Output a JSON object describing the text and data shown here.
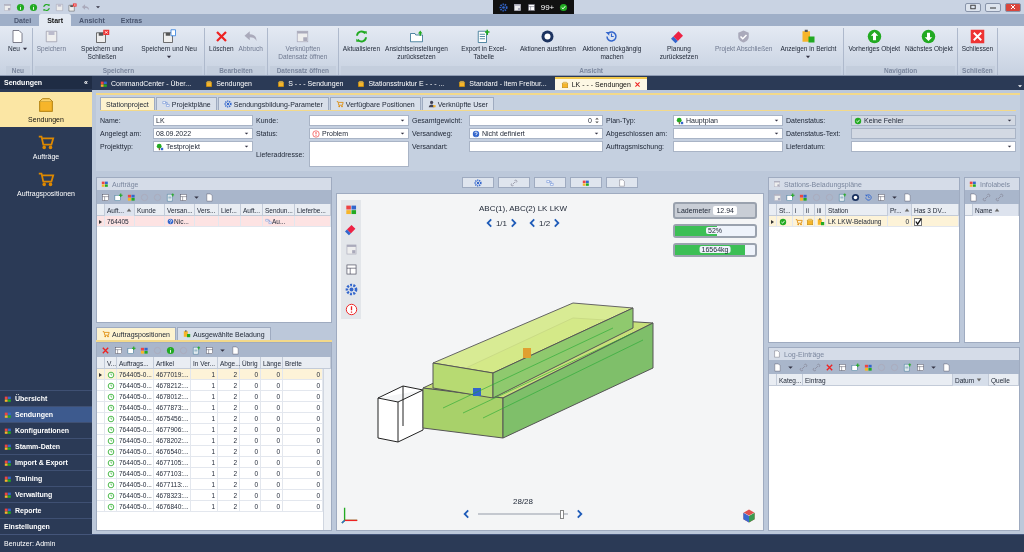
{
  "title_bar": {
    "badge": "99+"
  },
  "ribbon": {
    "tabs": [
      {
        "label": "Datei",
        "selected": false
      },
      {
        "label": "Start",
        "selected": true
      },
      {
        "label": "Ansicht",
        "selected": false
      },
      {
        "label": "Extras",
        "selected": false
      }
    ],
    "groups": [
      {
        "label": "Neu",
        "buttons": [
          {
            "label": "Neu",
            "dropdown": true,
            "disabled": false
          }
        ]
      },
      {
        "label": "Speichern",
        "buttons": [
          {
            "label": "Speichern",
            "dropdown": false,
            "disabled": true
          },
          {
            "label": "Speichern und Schließen",
            "dropdown": false,
            "disabled": false
          },
          {
            "label": "Speichern und Neu",
            "dropdown": true,
            "disabled": false
          }
        ]
      },
      {
        "label": "Bearbeiten",
        "buttons": [
          {
            "label": "Löschen",
            "dropdown": false,
            "disabled": false
          },
          {
            "label": "Abbruch",
            "dropdown": false,
            "disabled": true
          }
        ]
      },
      {
        "label": "Datensatz öffnen",
        "buttons": [
          {
            "label": "Verknüpften Datensatz öffnen",
            "dropdown": false,
            "disabled": true
          }
        ]
      },
      {
        "label": "Ansicht",
        "buttons": [
          {
            "label": "Aktualisieren",
            "dropdown": false,
            "disabled": false
          },
          {
            "label": "Ansichtseinstellungen zurücksetzen",
            "dropdown": false,
            "disabled": false
          },
          {
            "label": "Export in Excel-Tabelle",
            "dropdown": false,
            "disabled": false
          },
          {
            "label": "Aktionen ausführen",
            "dropdown": false,
            "disabled": false
          },
          {
            "label": "Aktionen rückgängig machen",
            "dropdown": false,
            "disabled": false
          },
          {
            "label": "Planung zurücksetzen",
            "dropdown": false,
            "disabled": false
          },
          {
            "label": "Projekt Abschließen",
            "dropdown": false,
            "disabled": true
          },
          {
            "label": "Anzeigen in Bericht",
            "dropdown": true,
            "disabled": false
          }
        ]
      },
      {
        "label": "Navigation",
        "buttons": [
          {
            "label": "Vorheriges Objekt",
            "dropdown": false,
            "disabled": false
          },
          {
            "label": "Nächstes Objekt",
            "dropdown": false,
            "disabled": false
          }
        ]
      },
      {
        "label": "Schließen",
        "buttons": [
          {
            "label": "Schliessen",
            "dropdown": false,
            "disabled": false
          }
        ]
      }
    ]
  },
  "sidebar": {
    "title": "Sendungen",
    "collapse": "«",
    "items": [
      {
        "label": "Sendungen",
        "selected": true
      },
      {
        "label": "Aufträge",
        "selected": false
      },
      {
        "label": "Auftragspositionen",
        "selected": false
      }
    ],
    "nav": [
      {
        "label": "Übersicht",
        "selected": false
      },
      {
        "label": "Sendungen",
        "selected": true
      },
      {
        "label": "Konfigurationen",
        "selected": false
      },
      {
        "label": "Stamm-Daten",
        "selected": false
      },
      {
        "label": "Import & Export",
        "selected": false
      },
      {
        "label": "Training",
        "selected": false
      },
      {
        "label": "Verwaltung",
        "selected": false
      },
      {
        "label": "Reporte",
        "selected": false
      },
      {
        "label": "Einstellungen",
        "selected": false
      }
    ]
  },
  "doc_tabs": [
    {
      "label": "CommandCenter - Über...",
      "selected": false
    },
    {
      "label": "Sendungen",
      "selected": false
    },
    {
      "label": "S - - - Sendungen",
      "selected": false
    },
    {
      "label": "Stationsstruktur E - - - ...",
      "selected": false
    },
    {
      "label": "Standard - item Freibur...",
      "selected": false
    },
    {
      "label": "LK - - - Sendungen",
      "selected": true
    }
  ],
  "form": {
    "tabs": [
      {
        "label": "Stationproject",
        "selected": true
      },
      {
        "label": "Projektpläne",
        "selected": false
      },
      {
        "label": "Sendungsbildung-Parameter",
        "selected": false
      },
      {
        "label": "Verfügbare Positionen",
        "selected": false
      },
      {
        "label": "Verknüpfte User",
        "selected": false
      }
    ],
    "columns": [
      [
        {
          "label": "Name:",
          "value": "LK",
          "kind": "text",
          "disabled": false
        },
        {
          "label": "Angelegt am:",
          "value": "08.09.2022",
          "kind": "combo",
          "disabled": false
        },
        {
          "label": "Projekttyp:",
          "value": "Testprojekt",
          "kind": "combo",
          "disabled": false
        }
      ],
      [
        {
          "label": "Kunde:",
          "kind": "combo",
          "disabled": false
        },
        {
          "label": "Status:",
          "value": "Problem",
          "kind": "combo",
          "disabled": false
        },
        {
          "label": "Lieferaddresse:",
          "kind": "memo",
          "disabled": false
        }
      ],
      [
        {
          "label": "Gesamtgewicht:",
          "value": "0",
          "kind": "spin",
          "disabled": false
        },
        {
          "label": "Versandweg:",
          "value": "Nicht definiert",
          "kind": "combo",
          "disabled": false
        },
        {
          "label": "Versandart:",
          "kind": "text",
          "disabled": false
        }
      ],
      [
        {
          "label": "Plan-Typ:",
          "value": "Hauptplan",
          "kind": "combo",
          "disabled": false
        },
        {
          "label": "Abgeschlossen am:",
          "kind": "combo",
          "disabled": false
        },
        {
          "label": "Auftragsmischung:",
          "kind": "text",
          "disabled": false
        }
      ],
      [
        {
          "label": "Datenstatus:",
          "value": "Keine Fehler",
          "kind": "combo",
          "disabled": true
        },
        {
          "label": "Datenstatus-Text:",
          "kind": "text",
          "disabled": true
        },
        {
          "label": "Lieferdatum:",
          "kind": "combo",
          "disabled": false
        }
      ]
    ]
  },
  "orders": {
    "title": "Aufträge",
    "columns": [
      {
        "label": "Auft...",
        "sorted_ascending": true,
        "sorted_descending": false
      },
      {
        "label": "Kunde",
        "sorted_ascending": false,
        "sorted_descending": false
      },
      {
        "label": "Versan...",
        "sorted_ascending": false,
        "sorted_descending": false
      },
      {
        "label": "Vers...",
        "sorted_ascending": false,
        "sorted_descending": false
      },
      {
        "label": "Lief...",
        "sorted_ascending": false,
        "sorted_descending": false
      },
      {
        "label": "Auft...",
        "sorted_ascending": false,
        "sorted_descending": false
      },
      {
        "label": "Sendun...",
        "sorted_ascending": false,
        "sorted_descending": false
      },
      {
        "label": "Lieferbe...",
        "sorted_ascending": false,
        "sorted_descending": false
      }
    ],
    "rows": [
      {
        "selected": true,
        "cells": [
          {
            "text": "764405"
          },
          {},
          {
            "text": "Nic..."
          },
          {},
          {},
          {},
          {
            "text": "Au..."
          },
          {}
        ]
      }
    ]
  },
  "positions": {
    "tabs": [
      {
        "label": "Auftragspositionen",
        "selected": true
      },
      {
        "label": "Ausgewählte Beladung",
        "selected": false
      }
    ],
    "columns": [
      {
        "label": "V...",
        "sorted_ascending": false,
        "sorted_descending": false
      },
      {
        "label": "Auftrags...",
        "sorted_ascending": false,
        "sorted_descending": false
      },
      {
        "label": "Artikel",
        "sorted_ascending": false,
        "sorted_descending": false
      },
      {
        "label": "In Ver...",
        "sorted_ascending": false,
        "sorted_descending": false
      },
      {
        "label": "Abge...",
        "sorted_ascending": false,
        "sorted_descending": false
      },
      {
        "label": "Übrig",
        "sorted_ascending": false,
        "sorted_descending": false
      },
      {
        "label": "Länge",
        "sorted_ascending": false,
        "sorted_descending": false
      },
      {
        "label": "Breite",
        "sorted_ascending": false,
        "sorted_descending": false
      }
    ],
    "rows": [
      {
        "selected": true,
        "cells": [
          "",
          "764405-0...",
          "4677019:...",
          "1",
          "2",
          "0",
          "0",
          "0"
        ]
      },
      {
        "selected": false,
        "cells": [
          "",
          "764405-0...",
          "4678212:...",
          "1",
          "2",
          "0",
          "0",
          "0"
        ]
      },
      {
        "selected": false,
        "cells": [
          "",
          "764405-0...",
          "4678012:...",
          "1",
          "2",
          "0",
          "0",
          "0"
        ]
      },
      {
        "selected": false,
        "cells": [
          "",
          "764405-0...",
          "4677873:...",
          "1",
          "2",
          "0",
          "0",
          "0"
        ]
      },
      {
        "selected": false,
        "cells": [
          "",
          "764405-0...",
          "4675456:...",
          "1",
          "2",
          "0",
          "0",
          "0"
        ]
      },
      {
        "selected": false,
        "cells": [
          "",
          "764405-0...",
          "4677906:...",
          "1",
          "2",
          "0",
          "0",
          "0"
        ]
      },
      {
        "selected": false,
        "cells": [
          "",
          "764405-0...",
          "4678202:...",
          "1",
          "2",
          "0",
          "0",
          "0"
        ]
      },
      {
        "selected": false,
        "cells": [
          "",
          "764405-0...",
          "4676540:...",
          "1",
          "2",
          "0",
          "0",
          "0"
        ]
      },
      {
        "selected": false,
        "cells": [
          "",
          "764405-0...",
          "4677105:...",
          "1",
          "2",
          "0",
          "0",
          "0"
        ]
      },
      {
        "selected": false,
        "cells": [
          "",
          "764405-0...",
          "4677103:...",
          "1",
          "2",
          "0",
          "0",
          "0"
        ]
      },
      {
        "selected": false,
        "cells": [
          "",
          "764405-0...",
          "4677113:...",
          "1",
          "2",
          "0",
          "0",
          "0"
        ]
      },
      {
        "selected": false,
        "cells": [
          "",
          "764405-0...",
          "4678323:...",
          "1",
          "2",
          "0",
          "0",
          "0"
        ]
      },
      {
        "selected": false,
        "cells": [
          "",
          "764405-0...",
          "4676840:...",
          "1",
          "2",
          "0",
          "0",
          "0"
        ]
      }
    ]
  },
  "viewer": {
    "title": "ABC(1), ABC(2)  LK LKW",
    "page_left": "1/1",
    "page_right": "1/2",
    "lademeter_label": "Lademeter",
    "lademeter_value": "12.94",
    "meters": [
      {
        "reading": "52%",
        "level": 0.52
      },
      {
        "reading": "16564kg",
        "level": 0.87
      }
    ],
    "frame": "28/28",
    "slider": {
      "level": 0.95
    }
  },
  "stations": {
    "title": "Stations-Beladungspläne",
    "columns": [
      {
        "label": "St...",
        "sorted_ascending": false,
        "sorted_descending": false
      },
      {
        "label": "i",
        "sorted_ascending": false,
        "sorted_descending": false
      },
      {
        "label": "ii",
        "sorted_ascending": false,
        "sorted_descending": false
      },
      {
        "label": "iii",
        "sorted_ascending": false,
        "sorted_descending": false
      },
      {
        "label": "Station",
        "sorted_ascending": false,
        "sorted_descending": false
      },
      {
        "label": "Pr...",
        "sorted_ascending": true,
        "sorted_descending": false
      },
      {
        "label": "Has 3 DV...",
        "sorted_ascending": false,
        "sorted_descending": false
      }
    ],
    "rows": [
      {
        "selected": true,
        "station": "LK LKW-Beladung",
        "priority": "0",
        "has_3d": true
      }
    ]
  },
  "infolabels": {
    "title": "Infolabels",
    "columns": [
      {
        "label": "Name",
        "sorted_ascending": true,
        "sorted_descending": false
      }
    ]
  },
  "log": {
    "title": "Log-Einträge",
    "columns": [
      {
        "label": "Kateg...",
        "sorted_ascending": false,
        "sorted_descending": false
      },
      {
        "label": "Eintrag",
        "sorted_ascending": false,
        "sorted_descending": false
      },
      {
        "label": "Datum",
        "sorted_ascending": false,
        "sorted_descending": true
      },
      {
        "label": "Quelle",
        "sorted_ascending": false,
        "sorted_descending": false
      }
    ]
  },
  "status_bar": {
    "user": "Benutzer: Admin"
  }
}
